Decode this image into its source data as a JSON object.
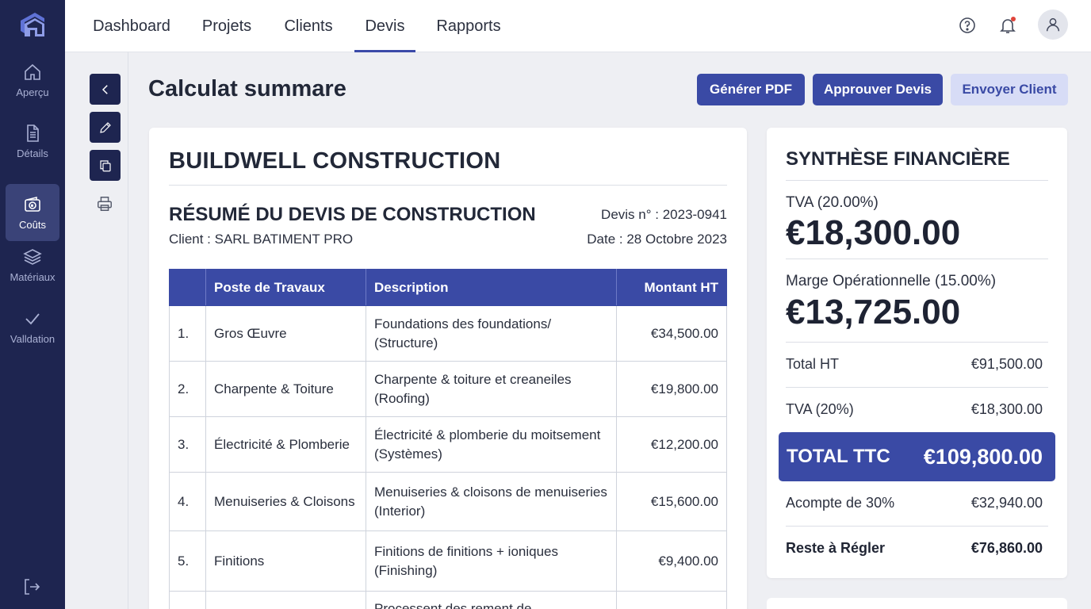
{
  "rail": {
    "items": [
      {
        "label": "Aperçu",
        "icon": "home-icon"
      },
      {
        "label": "Détails",
        "icon": "document-icon"
      },
      {
        "label": "Coûts",
        "icon": "wallet-euro-icon",
        "active": true
      },
      {
        "label": "Matériaux",
        "icon": "layers-icon"
      },
      {
        "label": "Valldation",
        "icon": "check-icon"
      }
    ]
  },
  "nav": {
    "tabs": [
      "Dashboard",
      "Projets",
      "Clients",
      "Devis",
      "Rapports"
    ],
    "active": "Devis"
  },
  "header": {
    "title": "Calculat summare",
    "buttons": {
      "pdf": "Générer PDF",
      "approve": "Approuver Devis",
      "send": "Envoyer Client"
    }
  },
  "document": {
    "company": "BUILDWELL CONSTRUCTION",
    "title": "RÉSUMÉ DU DEVIS DE CONSTRUCTION",
    "client": "Client : SARL BATIMENT PRO",
    "devis_no": "Devis n° : 2023-0941",
    "date": "Date : 28 Octobre 2023",
    "columns": [
      "",
      "Poste de Travaux",
      "Description",
      "Montant HT"
    ],
    "rows": [
      {
        "num": "1.",
        "poste": "Gros Œuvre",
        "desc1": "Foundations des foundations/",
        "desc2": "(Structure)",
        "amount": "€34,500.00"
      },
      {
        "num": "2.",
        "poste": "Charpente & Toiture",
        "desc1": "Charpente & toiture et creaneiles",
        "desc2": "(Roofing)",
        "amount": "€19,800.00"
      },
      {
        "num": "3.",
        "poste": "Électricité & Plomberie",
        "desc1": "Électricité & plomberie du moitsement",
        "desc2": "(Systèmes)",
        "amount": "€12,200.00"
      },
      {
        "num": "4.",
        "poste": "Menuiseries & Cloisons",
        "desc1": "Menuiseries & cloisons de menuiseries",
        "desc2": "(Interior)",
        "amount": "€15,600.00"
      },
      {
        "num": "5.",
        "poste": "Finitions",
        "desc1": "Finitions de finitions + ioniques",
        "desc2": "(Finishing)",
        "amount": "€9,400.00"
      },
      {
        "num": "",
        "poste": "",
        "desc1": "Processent des rement de",
        "desc2": "",
        "amount": ""
      }
    ]
  },
  "summary": {
    "title": "SYNTHÈSE FINANCIÈRE",
    "tva_label": "TVA (20.00%)",
    "tva_value": "€18,300.00",
    "marge_label": "Marge Opérationnelle (15.00%)",
    "marge_value": "€13,725.00",
    "total_ht_label": "Total HT",
    "total_ht_value": "€91,500.00",
    "tva2_label": "TVA (20%)",
    "tva2_value": "€18,300.00",
    "ttc_label": "TOTAL TTC",
    "ttc_value": "€109,800.00",
    "acompte_label": "Acompte de 30%",
    "acompte_value": "€32,940.00",
    "reste_label": "Reste à Régler",
    "reste_value": "€76,860.00"
  },
  "colors": {
    "rail": "#1e2550",
    "accent": "#3a4aa5",
    "accent_light": "#d7dcf6"
  }
}
